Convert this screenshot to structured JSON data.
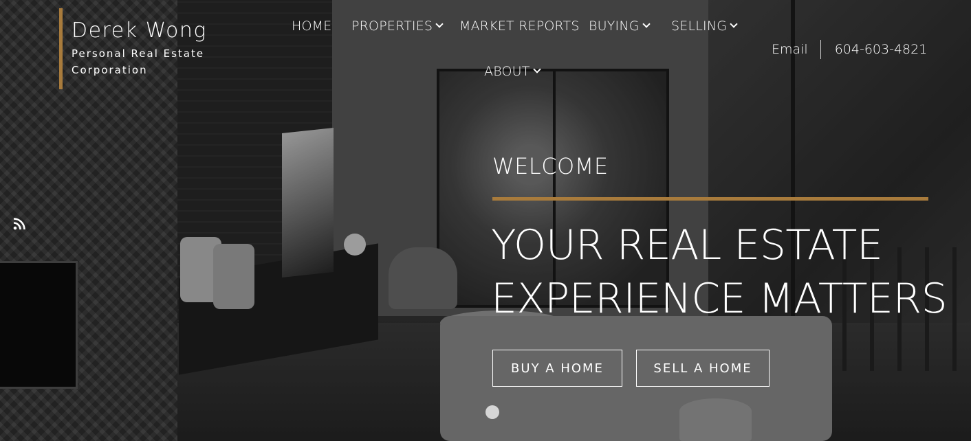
{
  "brand": {
    "name": "Derek Wong",
    "subtitle": "Personal Real Estate Corporation",
    "accent_color": "#a87b3c"
  },
  "nav": {
    "items": [
      {
        "label": "HOME",
        "has_dropdown": false
      },
      {
        "label": "PROPERTIES",
        "has_dropdown": true
      },
      {
        "label": "MARKET REPORTS",
        "has_dropdown": false
      },
      {
        "label": "BUYING",
        "has_dropdown": true
      },
      {
        "label": "SELLING",
        "has_dropdown": true
      },
      {
        "label": "ABOUT",
        "has_dropdown": true
      }
    ]
  },
  "contact": {
    "email_label": "Email",
    "phone": "604-603-4821"
  },
  "social": {
    "icon": "rss-icon"
  },
  "hero": {
    "welcome": "WELCOME",
    "title_line1": "YOUR REAL ESTATE",
    "title_line2": "EXPERIENCE MATTERS",
    "buy_button": "BUY A HOME",
    "sell_button": "SELL A HOME"
  }
}
